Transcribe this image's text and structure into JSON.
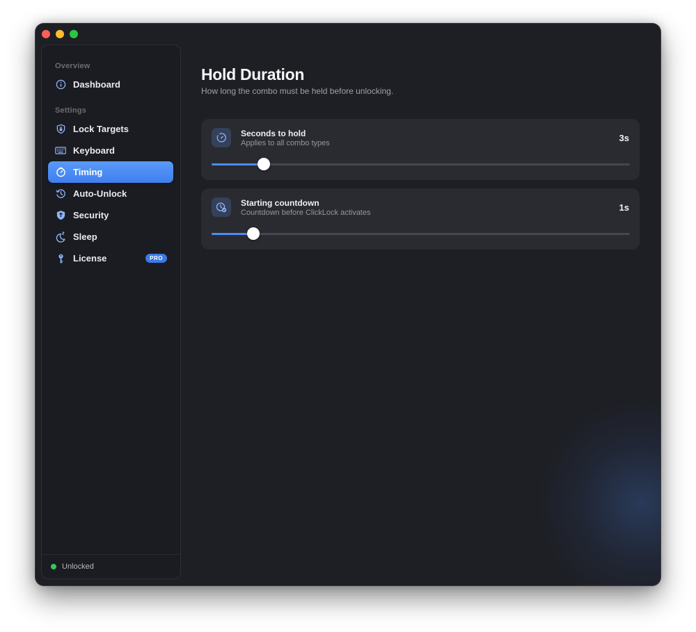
{
  "sidebar": {
    "sections": [
      {
        "label": "Overview"
      },
      {
        "label": "Settings"
      }
    ],
    "items": [
      {
        "label": "Dashboard",
        "icon": "info-icon",
        "active": false
      },
      {
        "label": "Lock Targets",
        "icon": "shield-lock-icon",
        "active": false
      },
      {
        "label": "Keyboard",
        "icon": "keyboard-icon",
        "active": false
      },
      {
        "label": "Timing",
        "icon": "timer-icon",
        "active": true
      },
      {
        "label": "Auto-Unlock",
        "icon": "clock-history-icon",
        "active": false
      },
      {
        "label": "Security",
        "icon": "shield-icon",
        "active": false
      },
      {
        "label": "Sleep",
        "icon": "moon-zzz-icon",
        "active": false
      },
      {
        "label": "License",
        "icon": "key-icon",
        "active": false,
        "badge": "PRO"
      }
    ],
    "footer": {
      "status": "Unlocked",
      "status_color": "#34c759"
    }
  },
  "main": {
    "title": "Hold Duration",
    "subtitle": "How long the combo must be held before unlocking.",
    "cards": [
      {
        "title": "Seconds to hold",
        "description": "Applies to all combo types",
        "value": "3s",
        "icon": "timer-icon",
        "slider_fraction": 0.125
      },
      {
        "title": "Starting countdown",
        "description": "Countdown before ClickLock activates",
        "value": "1s",
        "icon": "clock-badge-icon",
        "slider_fraction": 0.1
      }
    ]
  },
  "colors": {
    "accent": "#3f7ff0",
    "background": "#1e1f25",
    "card": "#2a2b31",
    "sidebar": "#1b1c21"
  }
}
